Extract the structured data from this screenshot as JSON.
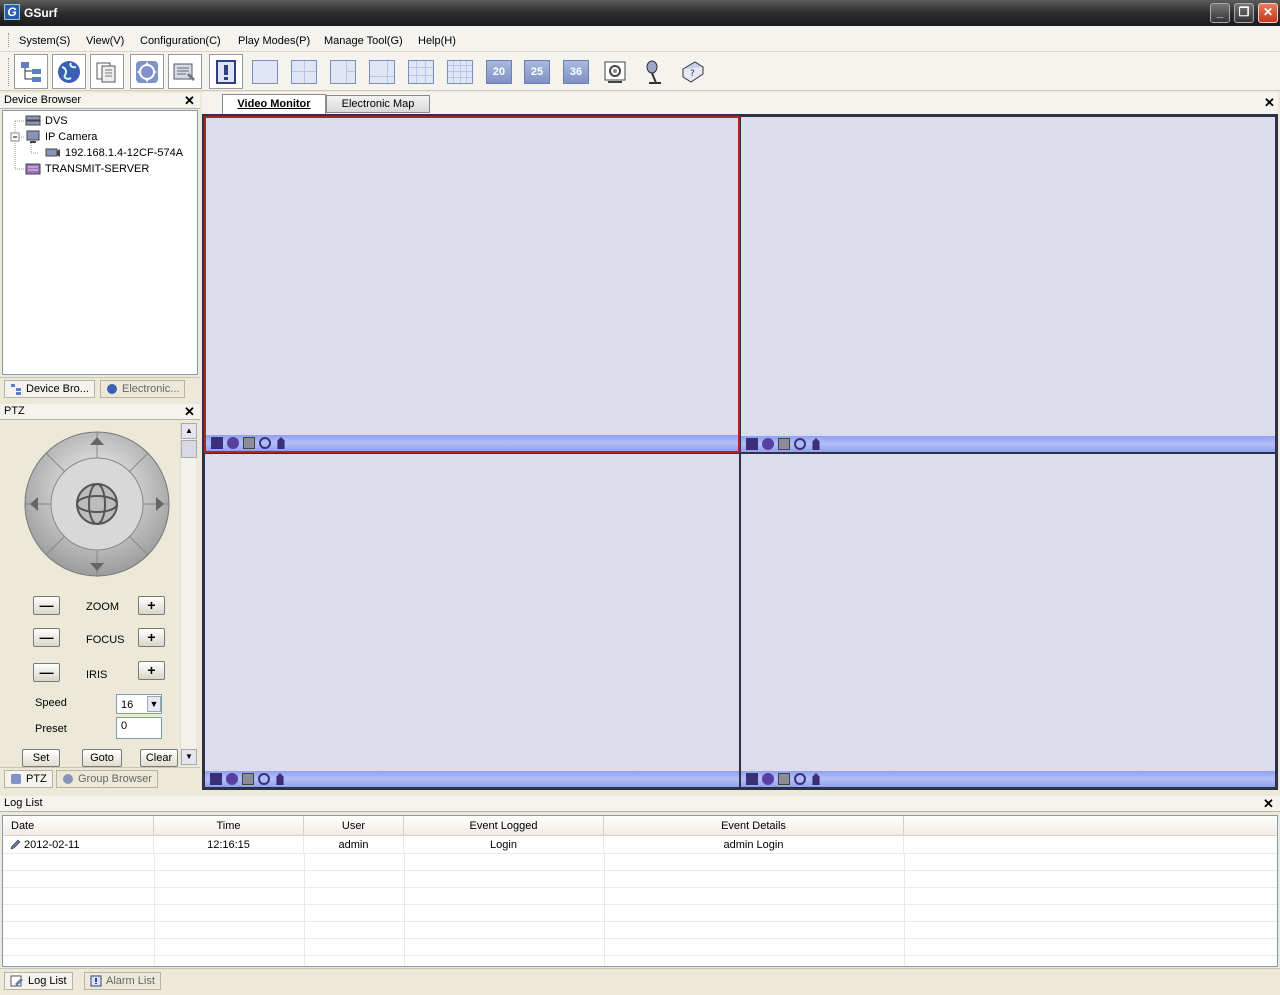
{
  "window": {
    "title": "GSurf",
    "icon": "gsurf-app-icon"
  },
  "menu": [
    {
      "label": "System(S)"
    },
    {
      "label": "View(V)"
    },
    {
      "label": "Configuration(C)"
    },
    {
      "label": "Play Modes(P)"
    },
    {
      "label": "Manage Tool(G)"
    },
    {
      "label": "Help(H)"
    }
  ],
  "toolbar": {
    "layout_numbers": {
      "n20": "20",
      "n25": "25",
      "n36": "36"
    }
  },
  "device_browser": {
    "title": "Device Browser",
    "tree": {
      "dvs": "DVS",
      "ip_camera": "IP Camera",
      "camera_node": "192.168.1.4-12CF-574A",
      "transmit": "TRANSMIT-SERVER"
    },
    "tabs": {
      "device": "Device Bro...",
      "electronic": "Electronic..."
    }
  },
  "ptz": {
    "title": "PTZ",
    "zoom": "ZOOM",
    "focus": "FOCUS",
    "iris": "IRIS",
    "speed_label": "Speed",
    "speed_value": "16",
    "preset_label": "Preset",
    "preset_value": "0",
    "set": "Set",
    "goto": "Goto",
    "clear": "Clear",
    "tabs": {
      "ptz": "PTZ",
      "group": "Group Browser"
    }
  },
  "video": {
    "tabs": {
      "monitor": "Video Monitor",
      "map": "Electronic Map"
    }
  },
  "log": {
    "title": "Log List",
    "columns": {
      "date": "Date",
      "time": "Time",
      "user": "User",
      "event": "Event Logged",
      "details": "Event Details"
    },
    "rows": [
      {
        "date": "2012-02-11",
        "time": "12:16:15",
        "user": "admin",
        "event": "Login",
        "details": "admin Login"
      }
    ],
    "tabs": {
      "log": "Log List",
      "alarm": "Alarm List"
    }
  },
  "colors": {
    "accent": "#b22222",
    "cell_bg": "#dcdcec",
    "bar": "#8fa0f0"
  }
}
